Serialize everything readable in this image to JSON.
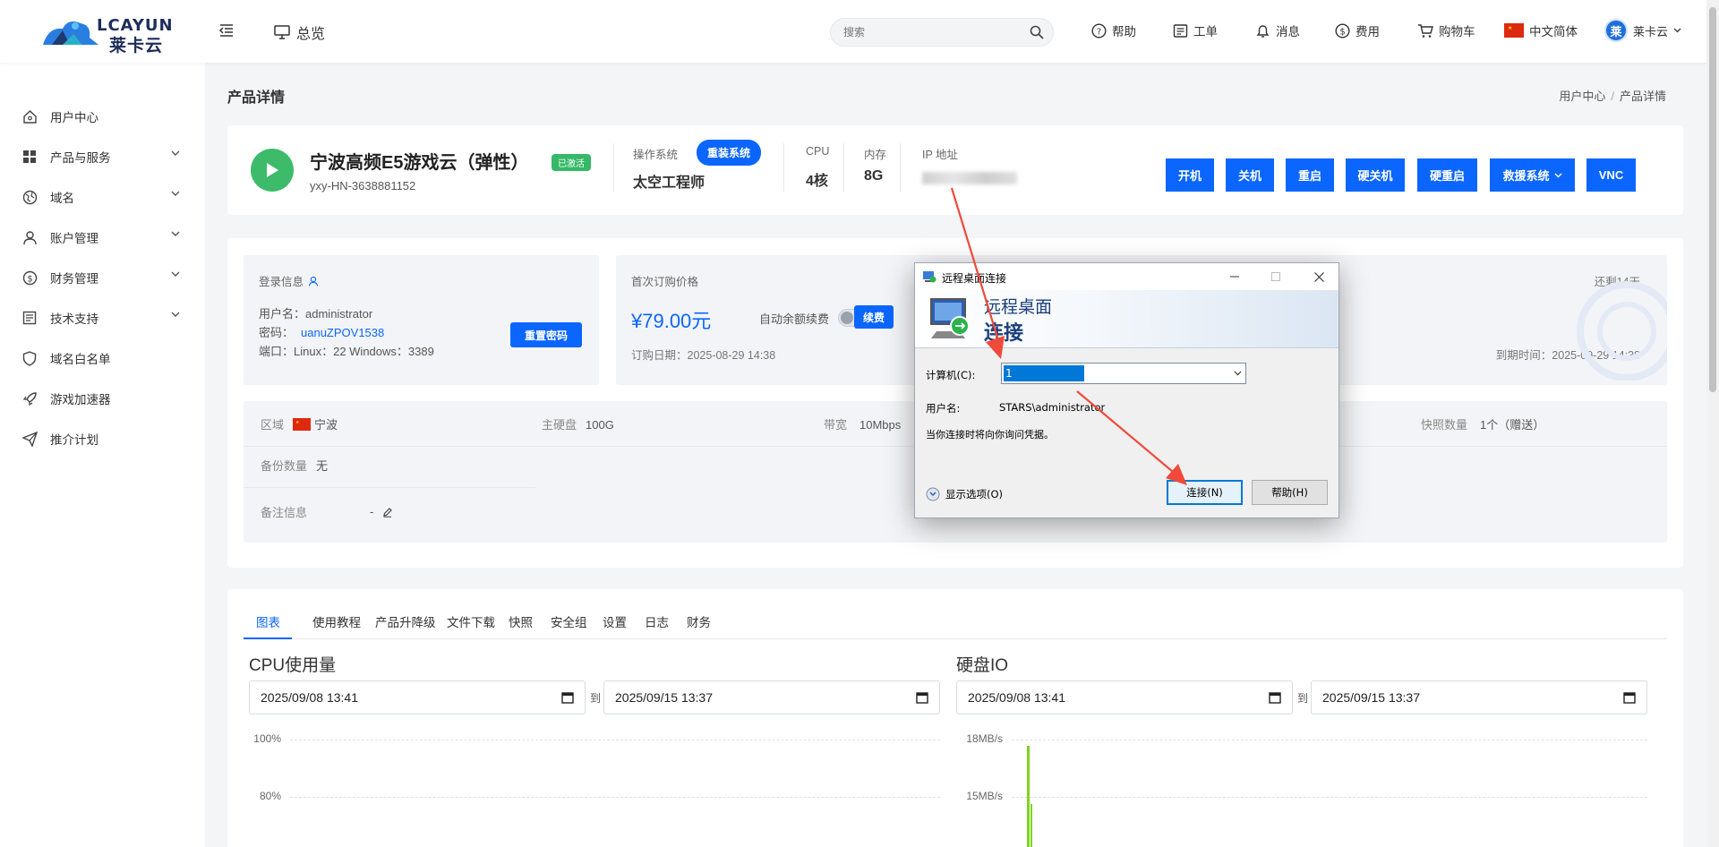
{
  "brand": {
    "logo_en": "LCAYUN",
    "logo_cn": "莱卡云"
  },
  "topbar": {
    "overview": "总览",
    "search_placeholder": "搜索",
    "help": "帮助",
    "ticket": "工单",
    "messages": "消息",
    "billing": "费用",
    "cart": "购物车",
    "language": "中文简体",
    "user_avatar": "莱",
    "user_name": "莱卡云"
  },
  "sidebar": {
    "items": [
      {
        "label": "用户中心",
        "icon": "home-icon"
      },
      {
        "label": "产品与服务",
        "icon": "grid-icon",
        "expandable": true
      },
      {
        "label": "域名",
        "icon": "globe-icon",
        "expandable": true
      },
      {
        "label": "账户管理",
        "icon": "user-icon",
        "expandable": true
      },
      {
        "label": "财务管理",
        "icon": "dollar-icon",
        "expandable": true
      },
      {
        "label": "技术支持",
        "icon": "doc-icon",
        "expandable": true
      },
      {
        "label": "域名白名单",
        "icon": "shield-icon"
      },
      {
        "label": "游戏加速器",
        "icon": "rocket-icon"
      },
      {
        "label": "推介计划",
        "icon": "send-icon"
      }
    ]
  },
  "page": {
    "title": "产品详情",
    "breadcrumb": [
      "用户中心",
      "产品详情"
    ]
  },
  "product": {
    "name": "宁波高频E5游戏云（弹性）",
    "status": "已激活",
    "id": "yxy-HN-3638881152",
    "os_label": "操作系统",
    "reinstall": "重装系统",
    "os_value": "太空工程师",
    "cpu_label": "CPU",
    "cpu_value": "4核",
    "mem_label": "内存",
    "mem_value": "8G",
    "ip_label": "IP 地址",
    "actions": [
      "开机",
      "关机",
      "重启",
      "硬关机",
      "硬重启",
      "救援系统",
      "VNC"
    ],
    "status_color": "#35b867",
    "accent": "#0a66ff"
  },
  "login": {
    "title": "登录信息",
    "username_label": "用户名：",
    "username": "administrator",
    "password_label": "密码：",
    "password": "uanuZPOV1538",
    "port_label": "端口：",
    "ports": "Linux：22 Windows：3389",
    "reset": "重置密码"
  },
  "billing": {
    "first_price_label": "首次订购价格",
    "price": "¥79.00元",
    "auto_renew_label": "自动余额续费",
    "renew": "续费",
    "order_date": "订购日期：2025-08-29 14:38",
    "remaining": "还剩14天",
    "expire": "到期时间：2025-09-29 14:38"
  },
  "specs": {
    "region_label": "区域",
    "region": "宁波",
    "disk_label": "主硬盘",
    "disk": "100G",
    "bandwidth_label": "带宽",
    "bandwidth": "10Mbps",
    "snapshot_label": "快照数量",
    "snapshot": "1个（赠送）",
    "backup_label": "备份数量",
    "backup": "无",
    "remark_label": "备注信息",
    "remark": "-"
  },
  "tabs": [
    "图表",
    "使用教程",
    "产品升降级",
    "文件下载",
    "快照",
    "安全组",
    "设置",
    "日志",
    "财务"
  ],
  "charts": {
    "cpu_title": "CPU使用量",
    "disk_title": "硬盘IO",
    "to": "到",
    "cpu_from": "2025/09/08  13:41",
    "cpu_to": "2025/09/15  13:37",
    "disk_from": "2025/09/08  13:41",
    "disk_to": "2025/09/15  13:37",
    "cpu_ticks": [
      "100%",
      "80%"
    ],
    "disk_ticks": [
      "18MB/s",
      "15MB/s"
    ]
  },
  "dialog": {
    "title": "远程桌面连接",
    "banner_line1": "远程桌面",
    "banner_line2": "连接",
    "computer_label": "计算机(C):",
    "computer_value": "1",
    "username_label": "用户名:",
    "username_value": "STARS\\administrator",
    "note": "当你连接时将向你询问凭据。",
    "show_options": "显示选项(O)",
    "connect": "连接(N)",
    "help": "帮助(H)"
  }
}
